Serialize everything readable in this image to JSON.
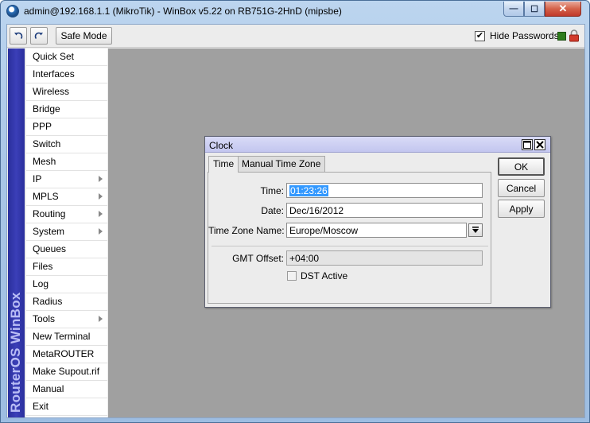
{
  "window": {
    "title": "admin@192.168.1.1 (MikroTik) - WinBox v5.22 on RB751G-2HnD (mipsbe)",
    "minimize": "—",
    "maximize": "☐",
    "close": "✕"
  },
  "toolbar": {
    "safe_mode_label": "Safe Mode",
    "hide_passwords_label": "Hide Passwords",
    "hide_passwords_checked": "✔",
    "status_color": "#2f7d1d"
  },
  "brand": "RouterOS WinBox",
  "menu": {
    "items": [
      {
        "label": "Quick Set"
      },
      {
        "label": "Interfaces"
      },
      {
        "label": "Wireless"
      },
      {
        "label": "Bridge"
      },
      {
        "label": "PPP"
      },
      {
        "label": "Switch"
      },
      {
        "label": "Mesh"
      },
      {
        "label": "IP"
      },
      {
        "label": "MPLS"
      },
      {
        "label": "Routing"
      },
      {
        "label": "System"
      },
      {
        "label": "Queues"
      },
      {
        "label": "Files"
      },
      {
        "label": "Log"
      },
      {
        "label": "Radius"
      },
      {
        "label": "Tools"
      },
      {
        "label": "New Terminal"
      },
      {
        "label": "MetaROUTER"
      },
      {
        "label": "Make Supout.rif"
      },
      {
        "label": "Manual"
      },
      {
        "label": "Exit"
      }
    ]
  },
  "clock": {
    "title": "Clock",
    "tabs": [
      "Time",
      "Manual Time Zone"
    ],
    "time_label": "Time:",
    "time_value": "01:23:26",
    "date_label": "Date:",
    "date_value": "Dec/16/2012",
    "tz_label": "Time Zone Name:",
    "tz_value": "Europe/Moscow",
    "gmt_label": "GMT Offset:",
    "gmt_value": "+04:00",
    "dst_label": "DST Active",
    "ok": "OK",
    "cancel": "Cancel",
    "apply": "Apply"
  }
}
